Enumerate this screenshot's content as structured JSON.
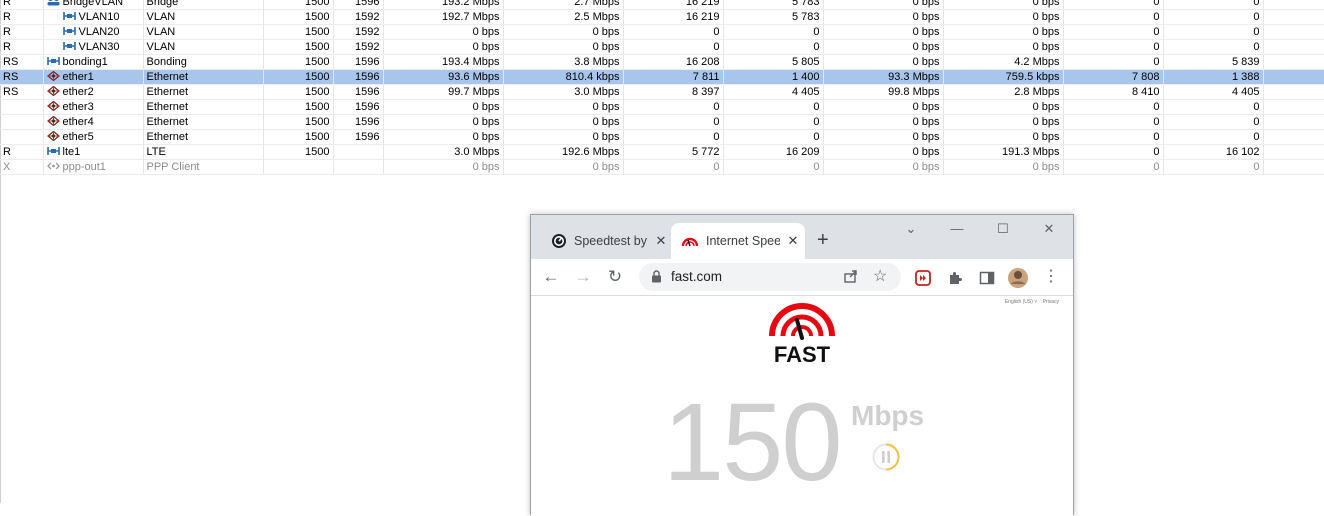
{
  "interfaces": [
    {
      "flags": "R",
      "name": "BridgeVLAN",
      "indent": 0,
      "icon": "bridge-icon",
      "type": "Bridge",
      "mtu": "1500",
      "l2mtu": "1596",
      "tx": "193.2 Mbps",
      "rx": "2.7 Mbps",
      "txp": "16 219",
      "rxp": "5 783",
      "ftx": "0 bps",
      "frx": "0 bps",
      "ftxp": "0",
      "frxp": "0"
    },
    {
      "flags": "R",
      "name": "VLAN10",
      "indent": 1,
      "icon": "vlan-icon",
      "type": "VLAN",
      "mtu": "1500",
      "l2mtu": "1592",
      "tx": "192.7 Mbps",
      "rx": "2.5 Mbps",
      "txp": "16 219",
      "rxp": "5 783",
      "ftx": "0 bps",
      "frx": "0 bps",
      "ftxp": "0",
      "frxp": "0"
    },
    {
      "flags": "R",
      "name": "VLAN20",
      "indent": 1,
      "icon": "vlan-icon",
      "type": "VLAN",
      "mtu": "1500",
      "l2mtu": "1592",
      "tx": "0 bps",
      "rx": "0 bps",
      "txp": "0",
      "rxp": "0",
      "ftx": "0 bps",
      "frx": "0 bps",
      "ftxp": "0",
      "frxp": "0"
    },
    {
      "flags": "R",
      "name": "VLAN30",
      "indent": 1,
      "icon": "vlan-icon",
      "type": "VLAN",
      "mtu": "1500",
      "l2mtu": "1592",
      "tx": "0 bps",
      "rx": "0 bps",
      "txp": "0",
      "rxp": "0",
      "ftx": "0 bps",
      "frx": "0 bps",
      "ftxp": "0",
      "frxp": "0"
    },
    {
      "flags": "RS",
      "name": "bonding1",
      "indent": 0,
      "icon": "bonding-icon",
      "type": "Bonding",
      "mtu": "1500",
      "l2mtu": "1596",
      "tx": "193.4 Mbps",
      "rx": "3.8 Mbps",
      "txp": "16 208",
      "rxp": "5 805",
      "ftx": "0 bps",
      "frx": "4.2 Mbps",
      "ftxp": "0",
      "frxp": "5 839"
    },
    {
      "flags": "RS",
      "name": "ether1",
      "indent": 0,
      "icon": "ethernet-icon",
      "type": "Ethernet",
      "mtu": "1500",
      "l2mtu": "1596",
      "tx": "93.6 Mbps",
      "rx": "810.4 kbps",
      "txp": "7 811",
      "rxp": "1 400",
      "ftx": "93.3 Mbps",
      "frx": "759.5 kbps",
      "ftxp": "7 808",
      "frxp": "1 388",
      "selected": true
    },
    {
      "flags": "RS",
      "name": "ether2",
      "indent": 0,
      "icon": "ethernet-icon",
      "type": "Ethernet",
      "mtu": "1500",
      "l2mtu": "1596",
      "tx": "99.7 Mbps",
      "rx": "3.0 Mbps",
      "txp": "8 397",
      "rxp": "4 405",
      "ftx": "99.8 Mbps",
      "frx": "2.8 Mbps",
      "ftxp": "8 410",
      "frxp": "4 405"
    },
    {
      "flags": "",
      "name": "ether3",
      "indent": 0,
      "icon": "ethernet-icon",
      "type": "Ethernet",
      "mtu": "1500",
      "l2mtu": "1596",
      "tx": "0 bps",
      "rx": "0 bps",
      "txp": "0",
      "rxp": "0",
      "ftx": "0 bps",
      "frx": "0 bps",
      "ftxp": "0",
      "frxp": "0"
    },
    {
      "flags": "",
      "name": "ether4",
      "indent": 0,
      "icon": "ethernet-icon",
      "type": "Ethernet",
      "mtu": "1500",
      "l2mtu": "1596",
      "tx": "0 bps",
      "rx": "0 bps",
      "txp": "0",
      "rxp": "0",
      "ftx": "0 bps",
      "frx": "0 bps",
      "ftxp": "0",
      "frxp": "0"
    },
    {
      "flags": "",
      "name": "ether5",
      "indent": 0,
      "icon": "ethernet-icon",
      "type": "Ethernet",
      "mtu": "1500",
      "l2mtu": "1596",
      "tx": "0 bps",
      "rx": "0 bps",
      "txp": "0",
      "rxp": "0",
      "ftx": "0 bps",
      "frx": "0 bps",
      "ftxp": "0",
      "frxp": "0"
    },
    {
      "flags": "R",
      "name": "lte1",
      "indent": 0,
      "icon": "lte-icon",
      "type": "LTE",
      "mtu": "1500",
      "l2mtu": "",
      "tx": "3.0 Mbps",
      "rx": "192.6 Mbps",
      "txp": "5 772",
      "rxp": "16 209",
      "ftx": "0 bps",
      "frx": "191.3 Mbps",
      "ftxp": "0",
      "frxp": "16 102"
    },
    {
      "flags": "X",
      "name": "ppp-out1",
      "indent": 0,
      "icon": "ppp-icon",
      "type": "PPP Client",
      "mtu": "",
      "l2mtu": "",
      "tx": "0 bps",
      "rx": "0 bps",
      "txp": "0",
      "rxp": "0",
      "ftx": "0 bps",
      "frx": "0 bps",
      "ftxp": "0",
      "frxp": "0",
      "disabled": true
    }
  ],
  "browser": {
    "tabs": [
      {
        "label": "Speedtest by Ookla",
        "icon": "speedtest-icon"
      },
      {
        "label": "Internet Speed Test",
        "icon": "fast-speedometer-icon",
        "active": true
      }
    ],
    "url": "fast.com",
    "top_links": [
      "English (US) ˅",
      "Privacy"
    ],
    "logo_text": "FAST",
    "speed_value": "150",
    "speed_unit": "Mbps",
    "colors": {
      "brand_red": "#e50914",
      "speed_gray": "#cfcfcf",
      "pause_ring": "#f5c242"
    }
  }
}
